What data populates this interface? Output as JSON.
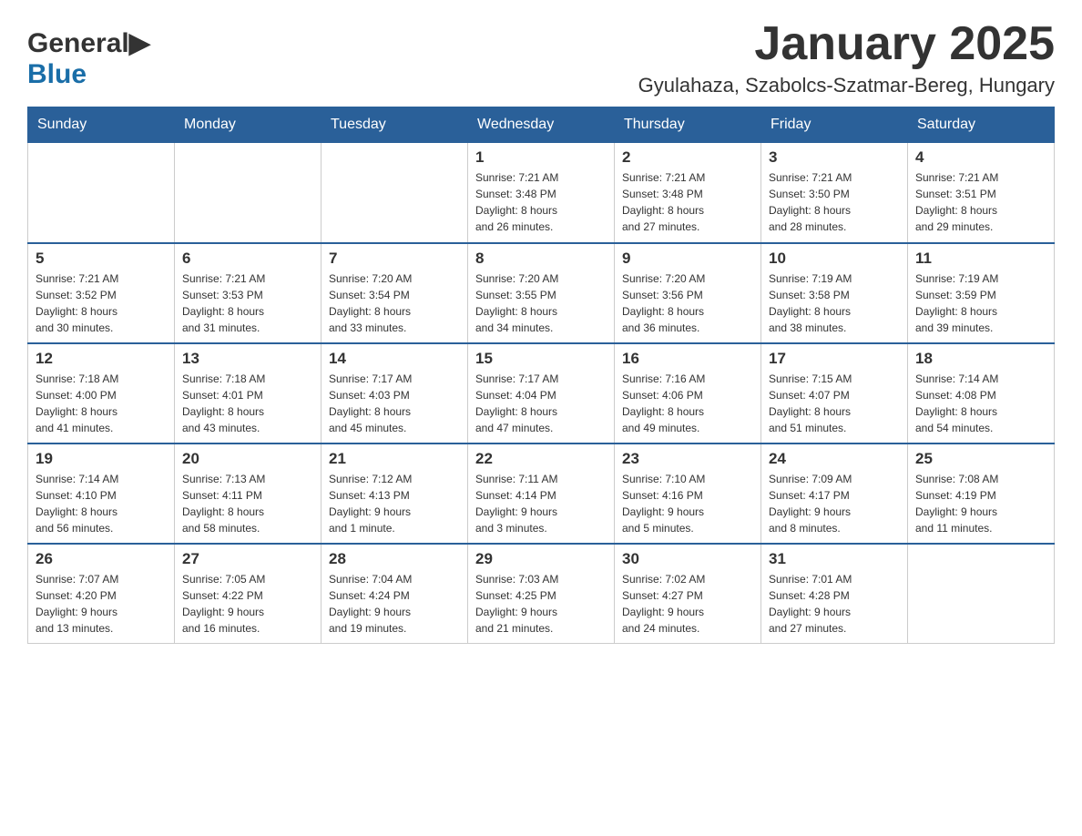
{
  "logo": {
    "general": "General",
    "blue": "Blue"
  },
  "title": "January 2025",
  "location": "Gyulahaza, Szabolcs-Szatmar-Bereg, Hungary",
  "weekdays": [
    "Sunday",
    "Monday",
    "Tuesday",
    "Wednesday",
    "Thursday",
    "Friday",
    "Saturday"
  ],
  "weeks": [
    [
      {
        "day": "",
        "info": ""
      },
      {
        "day": "",
        "info": ""
      },
      {
        "day": "",
        "info": ""
      },
      {
        "day": "1",
        "info": "Sunrise: 7:21 AM\nSunset: 3:48 PM\nDaylight: 8 hours\nand 26 minutes."
      },
      {
        "day": "2",
        "info": "Sunrise: 7:21 AM\nSunset: 3:48 PM\nDaylight: 8 hours\nand 27 minutes."
      },
      {
        "day": "3",
        "info": "Sunrise: 7:21 AM\nSunset: 3:50 PM\nDaylight: 8 hours\nand 28 minutes."
      },
      {
        "day": "4",
        "info": "Sunrise: 7:21 AM\nSunset: 3:51 PM\nDaylight: 8 hours\nand 29 minutes."
      }
    ],
    [
      {
        "day": "5",
        "info": "Sunrise: 7:21 AM\nSunset: 3:52 PM\nDaylight: 8 hours\nand 30 minutes."
      },
      {
        "day": "6",
        "info": "Sunrise: 7:21 AM\nSunset: 3:53 PM\nDaylight: 8 hours\nand 31 minutes."
      },
      {
        "day": "7",
        "info": "Sunrise: 7:20 AM\nSunset: 3:54 PM\nDaylight: 8 hours\nand 33 minutes."
      },
      {
        "day": "8",
        "info": "Sunrise: 7:20 AM\nSunset: 3:55 PM\nDaylight: 8 hours\nand 34 minutes."
      },
      {
        "day": "9",
        "info": "Sunrise: 7:20 AM\nSunset: 3:56 PM\nDaylight: 8 hours\nand 36 minutes."
      },
      {
        "day": "10",
        "info": "Sunrise: 7:19 AM\nSunset: 3:58 PM\nDaylight: 8 hours\nand 38 minutes."
      },
      {
        "day": "11",
        "info": "Sunrise: 7:19 AM\nSunset: 3:59 PM\nDaylight: 8 hours\nand 39 minutes."
      }
    ],
    [
      {
        "day": "12",
        "info": "Sunrise: 7:18 AM\nSunset: 4:00 PM\nDaylight: 8 hours\nand 41 minutes."
      },
      {
        "day": "13",
        "info": "Sunrise: 7:18 AM\nSunset: 4:01 PM\nDaylight: 8 hours\nand 43 minutes."
      },
      {
        "day": "14",
        "info": "Sunrise: 7:17 AM\nSunset: 4:03 PM\nDaylight: 8 hours\nand 45 minutes."
      },
      {
        "day": "15",
        "info": "Sunrise: 7:17 AM\nSunset: 4:04 PM\nDaylight: 8 hours\nand 47 minutes."
      },
      {
        "day": "16",
        "info": "Sunrise: 7:16 AM\nSunset: 4:06 PM\nDaylight: 8 hours\nand 49 minutes."
      },
      {
        "day": "17",
        "info": "Sunrise: 7:15 AM\nSunset: 4:07 PM\nDaylight: 8 hours\nand 51 minutes."
      },
      {
        "day": "18",
        "info": "Sunrise: 7:14 AM\nSunset: 4:08 PM\nDaylight: 8 hours\nand 54 minutes."
      }
    ],
    [
      {
        "day": "19",
        "info": "Sunrise: 7:14 AM\nSunset: 4:10 PM\nDaylight: 8 hours\nand 56 minutes."
      },
      {
        "day": "20",
        "info": "Sunrise: 7:13 AM\nSunset: 4:11 PM\nDaylight: 8 hours\nand 58 minutes."
      },
      {
        "day": "21",
        "info": "Sunrise: 7:12 AM\nSunset: 4:13 PM\nDaylight: 9 hours\nand 1 minute."
      },
      {
        "day": "22",
        "info": "Sunrise: 7:11 AM\nSunset: 4:14 PM\nDaylight: 9 hours\nand 3 minutes."
      },
      {
        "day": "23",
        "info": "Sunrise: 7:10 AM\nSunset: 4:16 PM\nDaylight: 9 hours\nand 5 minutes."
      },
      {
        "day": "24",
        "info": "Sunrise: 7:09 AM\nSunset: 4:17 PM\nDaylight: 9 hours\nand 8 minutes."
      },
      {
        "day": "25",
        "info": "Sunrise: 7:08 AM\nSunset: 4:19 PM\nDaylight: 9 hours\nand 11 minutes."
      }
    ],
    [
      {
        "day": "26",
        "info": "Sunrise: 7:07 AM\nSunset: 4:20 PM\nDaylight: 9 hours\nand 13 minutes."
      },
      {
        "day": "27",
        "info": "Sunrise: 7:05 AM\nSunset: 4:22 PM\nDaylight: 9 hours\nand 16 minutes."
      },
      {
        "day": "28",
        "info": "Sunrise: 7:04 AM\nSunset: 4:24 PM\nDaylight: 9 hours\nand 19 minutes."
      },
      {
        "day": "29",
        "info": "Sunrise: 7:03 AM\nSunset: 4:25 PM\nDaylight: 9 hours\nand 21 minutes."
      },
      {
        "day": "30",
        "info": "Sunrise: 7:02 AM\nSunset: 4:27 PM\nDaylight: 9 hours\nand 24 minutes."
      },
      {
        "day": "31",
        "info": "Sunrise: 7:01 AM\nSunset: 4:28 PM\nDaylight: 9 hours\nand 27 minutes."
      },
      {
        "day": "",
        "info": ""
      }
    ]
  ]
}
